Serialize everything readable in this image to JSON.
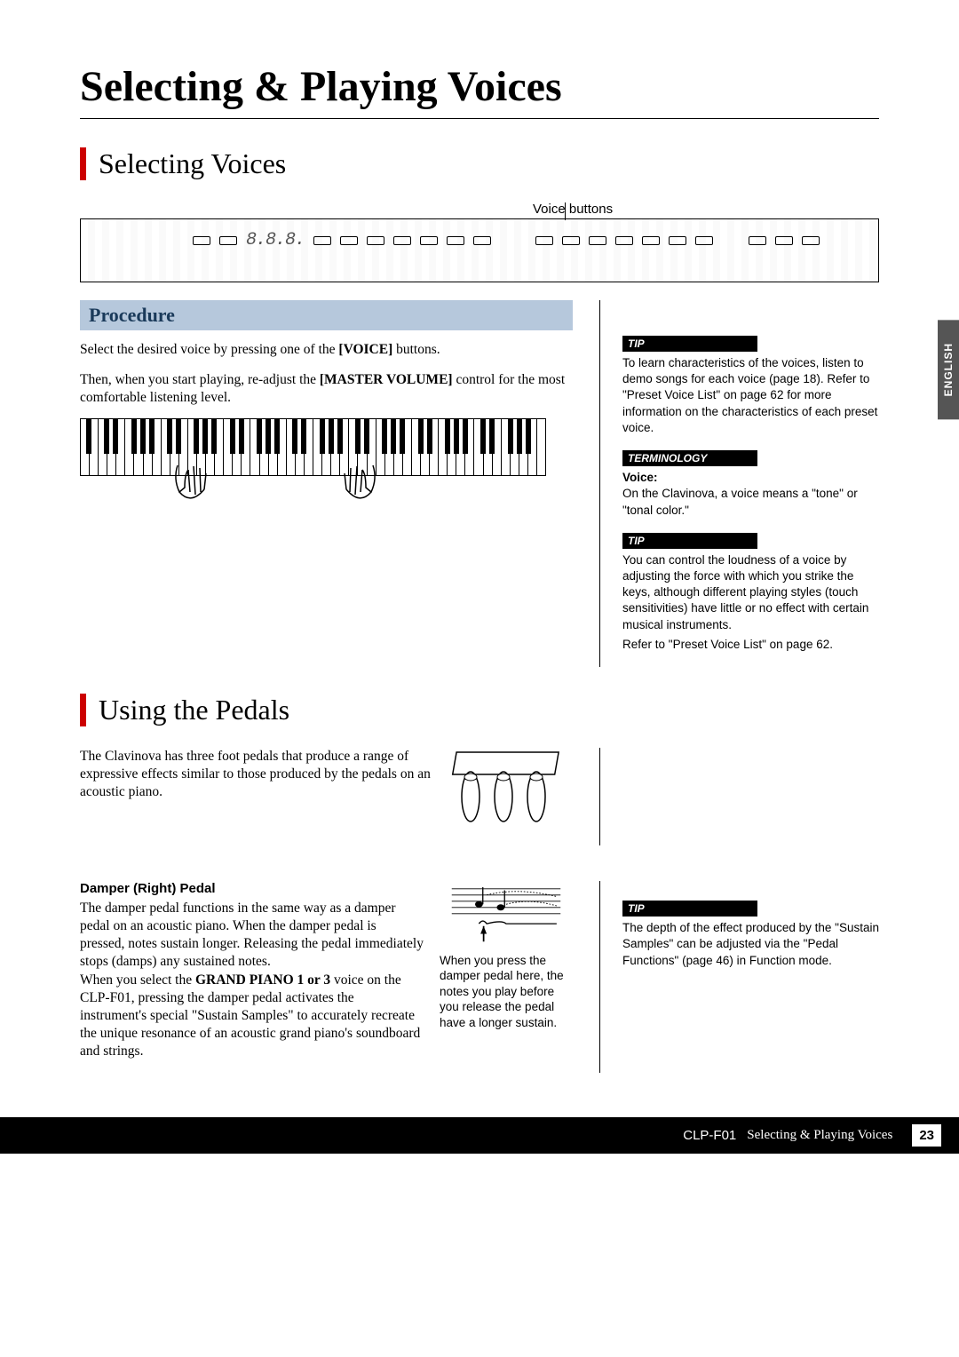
{
  "title": "Selecting & Playing Voices",
  "section1": "Selecting Voices",
  "voice_buttons_label": "Voice buttons",
  "panel": {
    "display": "8.8.8."
  },
  "procedure": {
    "heading": "Procedure",
    "p1_a": "Select the desired voice by pressing one of the ",
    "p1_bold": "[VOICE]",
    "p1_b": " buttons.",
    "p2_a": "Then, when you start playing, re-adjust the ",
    "p2_bold": "[MASTER VOLUME]",
    "p2_b": " control for the most comfortable listening level."
  },
  "sidebar": {
    "tip1_hdr": "TIP",
    "tip1": "To learn characteristics of the voices, listen to demo songs for each voice (page 18). Refer to \"Preset Voice List\" on page 62 for more information on the characteristics of each preset voice.",
    "term_hdr": "TERMINOLOGY",
    "term_bold": "Voice:",
    "term": "On the Clavinova, a voice means a \"tone\" or \"tonal color.\"",
    "tip2_hdr": "TIP",
    "tip2a": "You can control the loudness of a voice by adjusting the force with which you strike the keys, although different playing styles (touch sensitivities) have little or no effect with certain musical instruments.",
    "tip2b": "Refer to \"Preset Voice List\" on page 62.",
    "tip3_hdr": "TIP",
    "tip3": "The depth of the effect produced by the \"Sustain Samples\" can be adjusted via the \"Pedal Functions\" (page 46) in Function mode."
  },
  "lang": "ENGLISH",
  "section2": "Using the Pedals",
  "pedals_intro": "The Clavinova has three foot pedals that produce a range of expressive effects similar to those produced by the pedals on an acoustic piano.",
  "damper": {
    "heading": "Damper (Right) Pedal",
    "p1": "The damper pedal functions in the same way as a damper pedal on an acoustic piano. When the damper pedal is pressed, notes sustain longer. Releasing the pedal immediately stops (damps) any sustained notes.",
    "p2_a": "When you select the ",
    "p2_bold": "GRAND PIANO 1 or 3",
    "p2_b": " voice on the CLP-F01, pressing the damper pedal activates the instrument's special \"Sustain Samples\" to accurately recreate the unique resonance of an acoustic grand piano's soundboard and strings.",
    "caption": "When you press the damper pedal here, the notes you play before you release the pedal have a longer sustain."
  },
  "footer": {
    "model": "CLP-F01",
    "title": "Selecting & Playing Voices",
    "page": "23"
  }
}
